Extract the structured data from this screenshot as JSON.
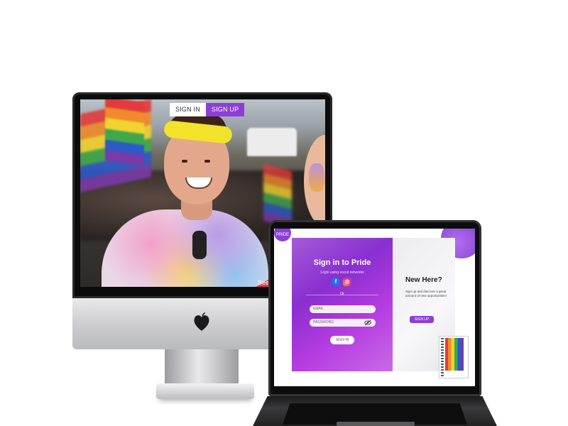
{
  "imac": {
    "tabs": {
      "sign_in": "SIGN IN",
      "sign_up": "SIGN UP"
    },
    "see_more": "See"
  },
  "laptop": {
    "badge": "PRIDE",
    "sign_in_panel": {
      "title": "Sign in to Pride",
      "social_hint": "Login using social networks",
      "or": "Or",
      "email_placeholder": "EMAIL",
      "password_placeholder": "PASSWORD",
      "button": "SIGN IN"
    },
    "new_here_panel": {
      "title": "New Here?",
      "description": "Sign up and discover a great amount of new opportunities!",
      "button": "SIGN UP"
    }
  },
  "colors": {
    "accent_purple": "#8e3ed8",
    "panel_gradient_start": "#a35bd8",
    "panel_gradient_end": "#c86ae8"
  },
  "icons": [
    "apple-icon",
    "facebook-icon",
    "instagram-icon",
    "eye-off-icon"
  ]
}
